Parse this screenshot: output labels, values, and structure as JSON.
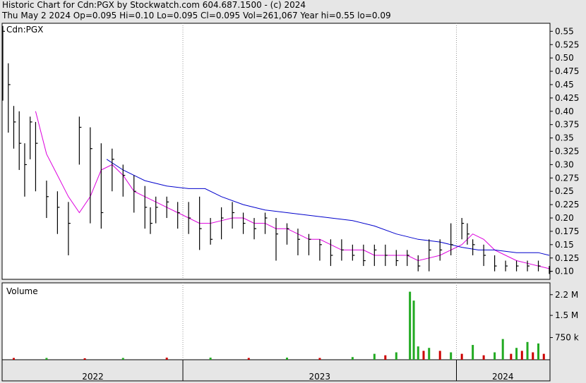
{
  "header": {
    "line1": "Historic Chart for Cdn:PGX by Stockwatch.com 604.687.1500 - (c) 2024",
    "line2": "Thu May  2 2024  Op=0.095  Hi=0.10  Lo=0.095  Cl=0.095  Vol=261,067  Year hi=0.55  lo=0.09"
  },
  "colors": {
    "background": "#e6e6e6",
    "plot_background": "#ffffff",
    "price_bars": "#000000",
    "ma_short": "#dd00dd",
    "ma_long": "#0000cc",
    "volume_up": "#22aa22",
    "volume_down": "#cc0000",
    "gridline": "#999999"
  },
  "chart_data": [
    {
      "type": "line",
      "name": "price-panel",
      "title": "Cdn:PGX",
      "ylim": [
        0.085,
        0.565
      ],
      "yticks": [
        "0.55",
        "0.525",
        "0.50",
        "0.475",
        "0.45",
        "0.425",
        "0.40",
        "0.375",
        "0.35",
        "0.325",
        "0.30",
        "0.275",
        "0.25",
        "0.225",
        "0.20",
        "0.175",
        "0.15",
        "0.125",
        "0.10"
      ],
      "x_labels": [
        "2022",
        "2023",
        "2024"
      ],
      "x_breaks": [
        0.3295,
        0.8301
      ],
      "grid": "vertical-dotted",
      "series": [
        {
          "name": "",
          "style": "price-bars",
          "x": [
            0,
            0.01,
            0.02,
            0.03,
            0.04,
            0.05,
            0.06,
            0.08,
            0.1,
            0.12,
            0.14,
            0.16,
            0.18,
            0.2,
            0.22,
            0.24,
            0.26,
            0.27,
            0.28,
            0.3,
            0.32,
            0.34,
            0.36,
            0.38,
            0.4,
            0.42,
            0.44,
            0.46,
            0.48,
            0.5,
            0.52,
            0.54,
            0.56,
            0.58,
            0.6,
            0.62,
            0.64,
            0.66,
            0.68,
            0.7,
            0.72,
            0.74,
            0.76,
            0.78,
            0.8,
            0.82,
            0.84,
            0.85,
            0.86,
            0.88,
            0.9,
            0.92,
            0.94,
            0.96,
            0.98,
            1.0
          ],
          "close": [
            0.55,
            0.45,
            0.38,
            0.34,
            0.3,
            0.38,
            0.34,
            0.24,
            0.22,
            0.19,
            0.37,
            0.33,
            0.21,
            0.31,
            0.28,
            0.25,
            0.22,
            0.19,
            0.22,
            0.23,
            0.21,
            0.2,
            0.18,
            0.16,
            0.2,
            0.21,
            0.19,
            0.18,
            0.2,
            0.17,
            0.18,
            0.16,
            0.16,
            0.15,
            0.13,
            0.14,
            0.13,
            0.12,
            0.14,
            0.13,
            0.12,
            0.13,
            0.11,
            0.14,
            0.14,
            0.15,
            0.19,
            0.17,
            0.15,
            0.13,
            0.11,
            0.11,
            0.11,
            0.11,
            0.11,
            0.1
          ],
          "high": [
            0.56,
            0.49,
            0.41,
            0.4,
            0.34,
            0.39,
            0.38,
            0.27,
            0.25,
            0.23,
            0.39,
            0.37,
            0.34,
            0.33,
            0.3,
            0.28,
            0.26,
            0.22,
            0.24,
            0.24,
            0.23,
            0.23,
            0.24,
            0.2,
            0.22,
            0.23,
            0.21,
            0.2,
            0.21,
            0.2,
            0.19,
            0.18,
            0.17,
            0.16,
            0.16,
            0.16,
            0.15,
            0.15,
            0.15,
            0.15,
            0.14,
            0.14,
            0.13,
            0.16,
            0.16,
            0.19,
            0.2,
            0.19,
            0.16,
            0.15,
            0.13,
            0.12,
            0.12,
            0.12,
            0.12,
            0.11
          ],
          "low": [
            0.42,
            0.36,
            0.33,
            0.29,
            0.24,
            0.31,
            0.25,
            0.2,
            0.17,
            0.13,
            0.3,
            0.19,
            0.18,
            0.25,
            0.24,
            0.21,
            0.18,
            0.17,
            0.19,
            0.2,
            0.18,
            0.17,
            0.14,
            0.15,
            0.16,
            0.18,
            0.17,
            0.16,
            0.17,
            0.12,
            0.15,
            0.13,
            0.13,
            0.12,
            0.11,
            0.12,
            0.12,
            0.11,
            0.11,
            0.11,
            0.11,
            0.11,
            0.1,
            0.1,
            0.12,
            0.13,
            0.16,
            0.15,
            0.13,
            0.11,
            0.1,
            0.1,
            0.1,
            0.1,
            0.1,
            0.095
          ]
        },
        {
          "name": "",
          "style": "ma-short",
          "x": [
            0.06,
            0.08,
            0.1,
            0.12,
            0.14,
            0.16,
            0.18,
            0.2,
            0.22,
            0.24,
            0.26,
            0.28,
            0.3,
            0.32,
            0.34,
            0.36,
            0.38,
            0.4,
            0.42,
            0.44,
            0.46,
            0.48,
            0.5,
            0.52,
            0.54,
            0.56,
            0.58,
            0.6,
            0.62,
            0.64,
            0.66,
            0.68,
            0.7,
            0.72,
            0.74,
            0.76,
            0.78,
            0.8,
            0.82,
            0.84,
            0.86,
            0.88,
            0.9,
            0.92,
            0.94,
            0.96,
            0.98,
            1.0
          ],
          "values": [
            0.4,
            0.32,
            0.28,
            0.24,
            0.21,
            0.24,
            0.29,
            0.3,
            0.28,
            0.25,
            0.24,
            0.23,
            0.22,
            0.21,
            0.2,
            0.19,
            0.19,
            0.195,
            0.2,
            0.2,
            0.19,
            0.19,
            0.18,
            0.18,
            0.17,
            0.16,
            0.16,
            0.15,
            0.14,
            0.14,
            0.14,
            0.13,
            0.13,
            0.13,
            0.13,
            0.12,
            0.125,
            0.13,
            0.14,
            0.15,
            0.17,
            0.16,
            0.14,
            0.13,
            0.12,
            0.115,
            0.11,
            0.105
          ]
        },
        {
          "name": "",
          "style": "ma-long",
          "x": [
            0.19,
            0.22,
            0.26,
            0.3,
            0.34,
            0.37,
            0.4,
            0.44,
            0.48,
            0.52,
            0.56,
            0.6,
            0.64,
            0.68,
            0.72,
            0.76,
            0.8,
            0.84,
            0.87,
            0.9,
            0.94,
            0.98,
            1.0
          ],
          "values": [
            0.31,
            0.29,
            0.27,
            0.26,
            0.255,
            0.255,
            0.24,
            0.225,
            0.215,
            0.21,
            0.205,
            0.2,
            0.195,
            0.185,
            0.17,
            0.16,
            0.155,
            0.145,
            0.14,
            0.14,
            0.135,
            0.135,
            0.13
          ]
        }
      ]
    },
    {
      "type": "bar",
      "name": "volume-panel",
      "title": "Volume",
      "ylim": [
        0,
        2600000
      ],
      "yticks": [
        "2.2 M",
        "1.5 M",
        "750 k"
      ],
      "ytick_values": [
        2200000,
        1500000,
        750000
      ],
      "series": [
        {
          "name": "",
          "x": [
            0.02,
            0.08,
            0.15,
            0.22,
            0.3,
            0.38,
            0.45,
            0.52,
            0.58,
            0.64,
            0.68,
            0.7,
            0.72,
            0.745,
            0.752,
            0.76,
            0.77,
            0.78,
            0.8,
            0.82,
            0.84,
            0.86,
            0.88,
            0.9,
            0.915,
            0.93,
            0.94,
            0.95,
            0.96,
            0.97,
            0.98,
            0.99
          ],
          "values": [
            60000,
            60000,
            50000,
            60000,
            70000,
            70000,
            60000,
            70000,
            60000,
            90000,
            200000,
            150000,
            250000,
            2300000,
            2000000,
            450000,
            300000,
            400000,
            300000,
            250000,
            200000,
            500000,
            150000,
            250000,
            700000,
            200000,
            400000,
            300000,
            600000,
            250000,
            550000,
            200000
          ],
          "direction": [
            "down",
            "up",
            "down",
            "up",
            "down",
            "up",
            "down",
            "up",
            "down",
            "up",
            "up",
            "down",
            "up",
            "up",
            "up",
            "up",
            "down",
            "up",
            "down",
            "up",
            "down",
            "up",
            "down",
            "up",
            "up",
            "down",
            "up",
            "down",
            "up",
            "down",
            "up",
            "down"
          ]
        }
      ]
    }
  ]
}
